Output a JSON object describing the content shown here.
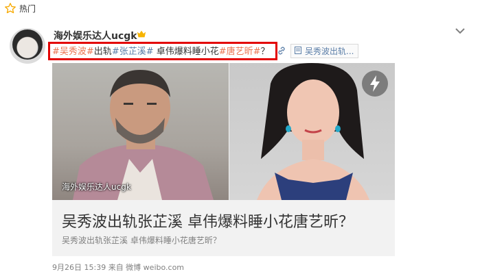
{
  "topbar": {
    "label": "热门",
    "icon": "star-icon"
  },
  "post": {
    "username": "海外娱乐达人ucgk",
    "verified_icon": "vip-crown-icon",
    "text_segments": [
      {
        "text": "#吴秀波#",
        "kind": "tag"
      },
      {
        "text": "出轨",
        "kind": "plain"
      },
      {
        "text": "#张芷溪#",
        "kind": "tag2"
      },
      {
        "text": " 卓伟爆料睡小花",
        "kind": "plain"
      },
      {
        "text": "#唐艺昕#",
        "kind": "tag"
      },
      {
        "text": "？",
        "kind": "plain"
      }
    ],
    "link_pill": "吴秀波出轨...",
    "media": {
      "watermark": "海外娱乐达人ucgk",
      "title": "吴秀波出轨张芷溪 卓伟爆料睡小花唐艺昕？",
      "description": "吴秀波出轨张芷溪 卓伟爆料睡小花唐艺昕？"
    },
    "meta": "9月26日 15:39  来自 微博 weibo.com"
  },
  "colors": {
    "tag": "#eb7350",
    "link": "#5b7ea8",
    "highlight": "#e30000",
    "verified": "#f7b400"
  }
}
